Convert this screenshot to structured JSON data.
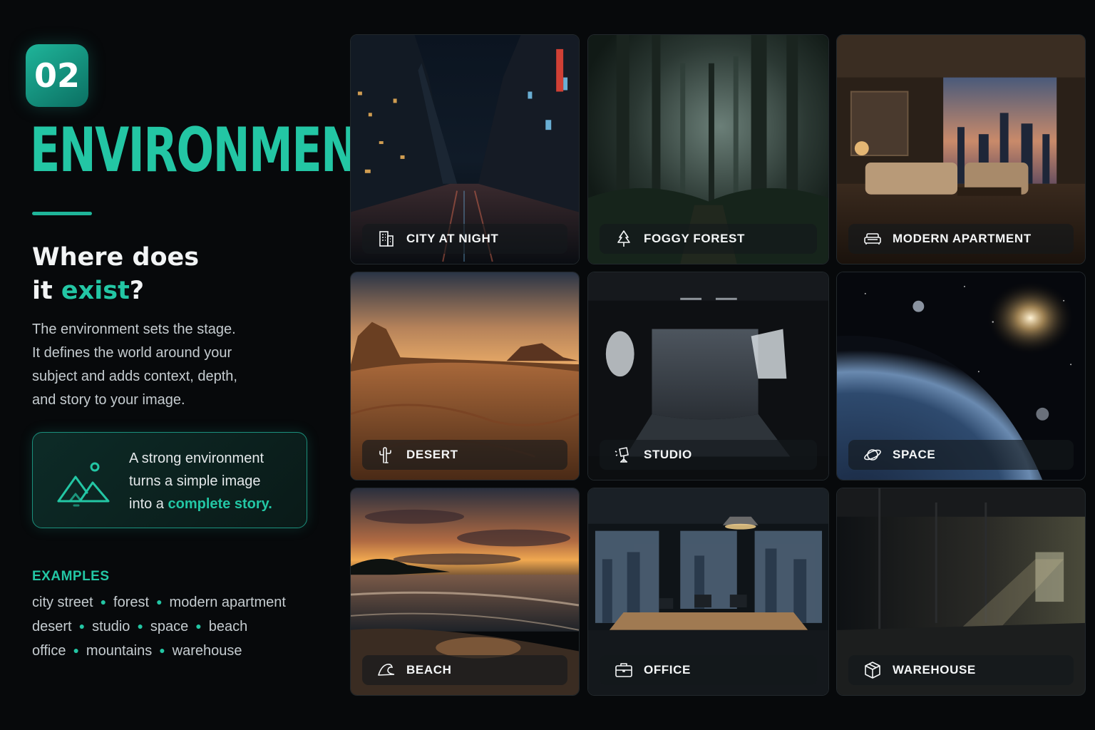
{
  "badge": "02",
  "title": "ENVIRONMENT",
  "question": {
    "line1": "Where does",
    "line2_pre": "it ",
    "line2_hl": "exist",
    "line2_post": "?"
  },
  "description": [
    "The environment sets the stage.",
    "It defines the world around your",
    "subject and adds context, depth,",
    "and story to your image."
  ],
  "callout": {
    "icon": "mountain-icon",
    "line1": "A strong environment",
    "line2": "turns a simple image",
    "line3_pre": "into a ",
    "line3_hl": "complete story."
  },
  "examples": {
    "label": "EXAMPLES",
    "rows": [
      [
        "city street",
        "forest",
        "modern apartment"
      ],
      [
        "desert",
        "studio",
        "space",
        "beach"
      ],
      [
        "office",
        "mountains",
        "warehouse"
      ]
    ]
  },
  "colors": {
    "accent": "#23c6a4",
    "background": "#07090b"
  },
  "tiles": [
    {
      "label": "CITY AT NIGHT",
      "icon": "building-icon"
    },
    {
      "label": "FOGGY FOREST",
      "icon": "tree-icon"
    },
    {
      "label": "MODERN APARTMENT",
      "icon": "sofa-icon"
    },
    {
      "label": "DESERT",
      "icon": "cactus-icon"
    },
    {
      "label": "STUDIO",
      "icon": "studio-light-icon"
    },
    {
      "label": "SPACE",
      "icon": "planet-icon"
    },
    {
      "label": "BEACH",
      "icon": "wave-icon"
    },
    {
      "label": "OFFICE",
      "icon": "briefcase-icon"
    },
    {
      "label": "WAREHOUSE",
      "icon": "box-icon"
    }
  ]
}
